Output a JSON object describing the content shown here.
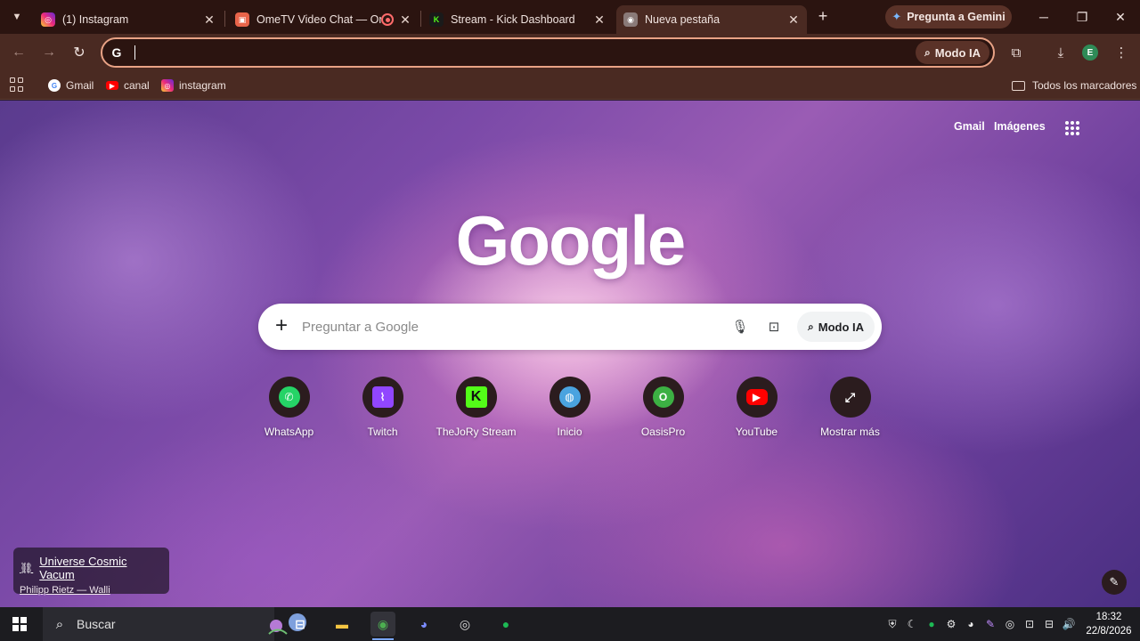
{
  "tabs": [
    {
      "title": "(1) Instagram",
      "icon": "instagram-icon"
    },
    {
      "title": "OmeTV Video Chat — Ome",
      "icon": "ometv-icon"
    },
    {
      "title": "Stream - Kick Dashboard",
      "icon": "kick-icon"
    },
    {
      "title": "Nueva pestaña",
      "icon": "chrome-icon",
      "active": true
    }
  ],
  "gemini_button": "Pregunta a Gemini",
  "omnibox": {
    "value": "",
    "placeholder": "",
    "ai_mode_label": "Modo IA"
  },
  "profile_initial": "E",
  "bookmarks": [
    {
      "label": "Gmail",
      "icon": "google-icon"
    },
    {
      "label": "canal",
      "icon": "youtube-icon"
    },
    {
      "label": "instagram",
      "icon": "instagram-icon"
    }
  ],
  "all_bookmarks_label": "Todos los marcadores",
  "ntp": {
    "top_links": {
      "gmail": "Gmail",
      "images": "Imágenes"
    },
    "logo": "Google",
    "search": {
      "placeholder": "Preguntar a Google",
      "ai_mode_label": "Modo IA"
    },
    "shortcuts": [
      {
        "label": "WhatsApp",
        "icon": "whatsapp-icon",
        "color": "#25d366"
      },
      {
        "label": "Twitch",
        "icon": "twitch-icon",
        "color": "#9146ff"
      },
      {
        "label": "TheJoRy Stream",
        "icon": "kick-icon",
        "color": "#53fc18"
      },
      {
        "label": "Inicio",
        "icon": "globe-icon",
        "color": "#4aa3df"
      },
      {
        "label": "OasisPro",
        "icon": "oasispro-icon",
        "color": "#3cb043"
      },
      {
        "label": "YouTube",
        "icon": "youtube-icon",
        "color": "#ff0000"
      },
      {
        "label": "Mostrar más",
        "icon": "expand-icon",
        "color": "#ffffff"
      }
    ],
    "attribution": {
      "title": "Universe Cosmic Vacum",
      "author": "Philipp Rietz — Walli"
    }
  },
  "taskbar": {
    "search_label": "Buscar",
    "time": "18:32",
    "date": "22/8/2026"
  },
  "colors": {
    "accent_omnibox_border": "#e8a285",
    "tab_strip": "#2b1410",
    "toolbar": "#4a2a22"
  }
}
